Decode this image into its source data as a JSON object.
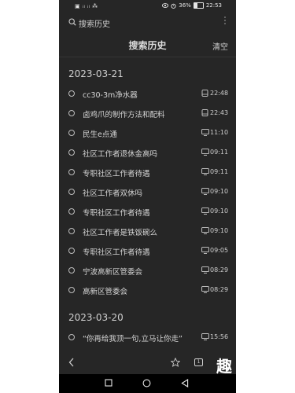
{
  "status": {
    "left_text": "▣ ᵢₗ ᵢₗ ⁂",
    "battery": "36%",
    "battery_fraction": 0.36,
    "time": "22:53"
  },
  "search": {
    "placeholder": "搜索历史"
  },
  "header": {
    "title": "搜索历史",
    "clear": "清空"
  },
  "sections": [
    {
      "date": "2023-03-21",
      "items": [
        {
          "text": "cc30-3m净水器",
          "device": "tablet-icon",
          "time": "22:48"
        },
        {
          "text": "卤鸡爪的制作方法和配料",
          "device": "tablet-icon",
          "time": "22:43"
        },
        {
          "text": "民生e点通",
          "device": "monitor-icon",
          "time": "11:10"
        },
        {
          "text": "社区工作者退休金高吗",
          "device": "monitor-icon",
          "time": "09:11"
        },
        {
          "text": "专职社区工作者待遇",
          "device": "monitor-icon",
          "time": "09:11"
        },
        {
          "text": "社区工作者双休吗",
          "device": "monitor-icon",
          "time": "09:10"
        },
        {
          "text": "专职社区工作者待遇",
          "device": "monitor-icon",
          "time": "09:10"
        },
        {
          "text": "社区工作者是铁饭碗么",
          "device": "monitor-icon",
          "time": "09:10"
        },
        {
          "text": "专职社区工作者待遇",
          "device": "monitor-icon",
          "time": "09:05"
        },
        {
          "text": "宁波高新区管委会",
          "device": "monitor-icon",
          "time": "08:29"
        },
        {
          "text": "高新区管委会",
          "device": "monitor-icon",
          "time": "08:29"
        }
      ]
    },
    {
      "date": "2023-03-20",
      "items": [
        {
          "text": "“你再给我顶一句,立马让你走”",
          "device": "monitor-icon",
          "time": "15:56"
        }
      ]
    }
  ],
  "bottom": {
    "tabs_count": "1",
    "logo": "趣"
  }
}
